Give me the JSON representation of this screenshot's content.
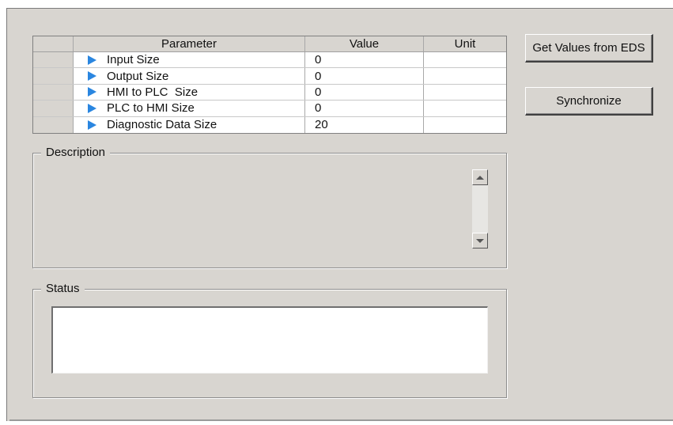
{
  "grid": {
    "headers": {
      "parameter": "Parameter",
      "value": "Value",
      "unit": "Unit"
    },
    "rows": [
      {
        "parameter": "Input Size",
        "value": "0",
        "unit": ""
      },
      {
        "parameter": "Output Size",
        "value": "0",
        "unit": ""
      },
      {
        "parameter": "HMI to PLC  Size",
        "value": "0",
        "unit": ""
      },
      {
        "parameter": "PLC to HMI Size",
        "value": "0",
        "unit": ""
      },
      {
        "parameter": "Diagnostic Data Size",
        "value": "20",
        "unit": ""
      }
    ]
  },
  "buttons": {
    "get_values_label": "Get Values from EDS",
    "synchronize_label": "Synchronize"
  },
  "description": {
    "legend": "Description",
    "text": ""
  },
  "status": {
    "legend": "Status",
    "text": ""
  },
  "colors": {
    "panel_bg": "#d8d5d0",
    "arrow": "#2a86e0"
  },
  "icons": {
    "row_marker": "right-triangle-icon",
    "scroll_up": "scroll-up-icon",
    "scroll_down": "scroll-down-icon"
  }
}
